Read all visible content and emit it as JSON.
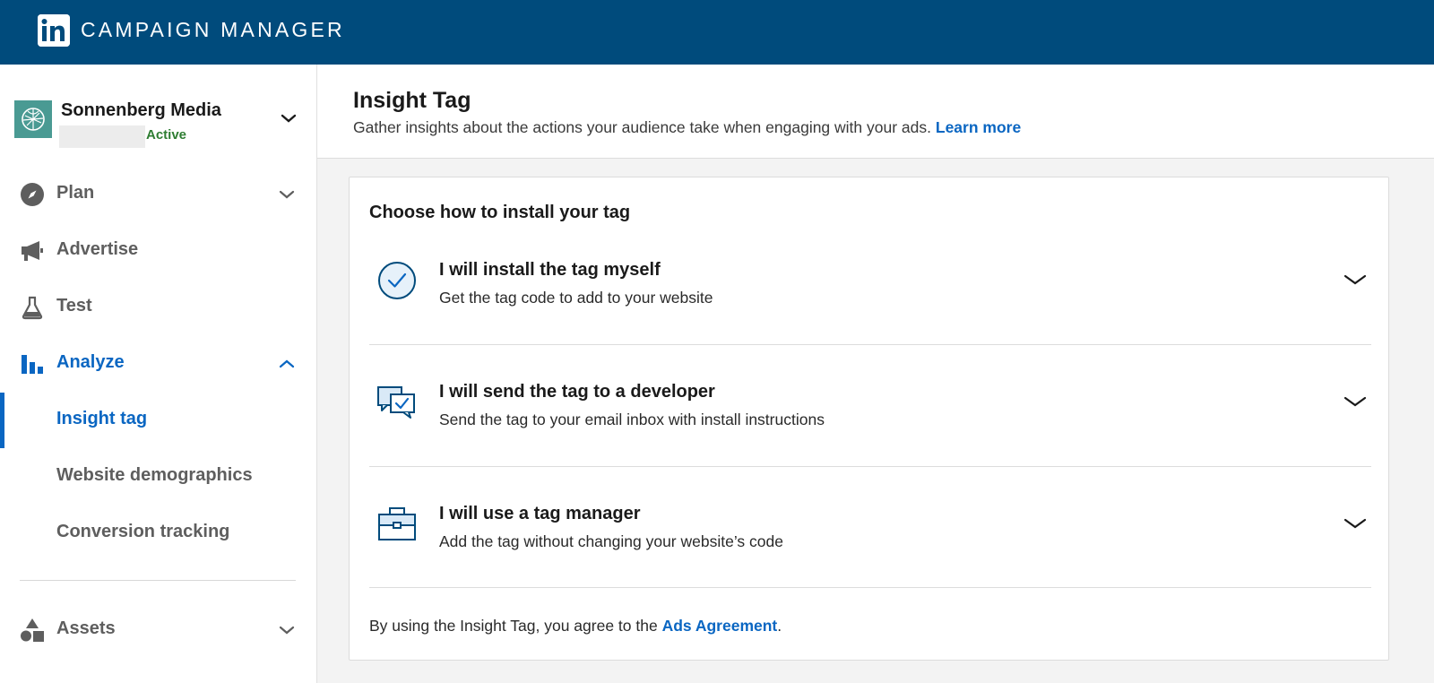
{
  "topbar": {
    "logo_text": "in",
    "app_name": "CAMPAIGN MANAGER"
  },
  "account": {
    "name": "Sonnenberg Media",
    "status": "Active"
  },
  "sidebar": {
    "items": [
      {
        "label": "Plan"
      },
      {
        "label": "Advertise"
      },
      {
        "label": "Test"
      },
      {
        "label": "Analyze"
      },
      {
        "label": "Assets"
      }
    ],
    "analyze_sub": [
      {
        "label": "Insight tag"
      },
      {
        "label": "Website demographics"
      },
      {
        "label": "Conversion tracking"
      }
    ]
  },
  "main": {
    "title": "Insight Tag",
    "description": "Gather insights about the actions your audience take when engaging with your ads.",
    "learn_more": "Learn more"
  },
  "card": {
    "title": "Choose how to install your tag",
    "options": [
      {
        "title": "I will install the tag myself",
        "desc": "Get the tag code to add to your website",
        "icon": "check-circle-icon"
      },
      {
        "title": "I will send the tag to a developer",
        "desc": "Send the tag to your email inbox with install instructions",
        "icon": "chat-check-icon"
      },
      {
        "title": "I will use a tag manager",
        "desc": "Add the tag without changing your website’s code",
        "icon": "briefcase-icon"
      }
    ],
    "agree_prefix": "By using the Insight Tag, you agree to the",
    "agree_link": "Ads Agreement",
    "agree_suffix": "."
  },
  "colors": {
    "brand": "#004b7c",
    "link": "#0a66c2",
    "active_status": "#2e7d32"
  }
}
